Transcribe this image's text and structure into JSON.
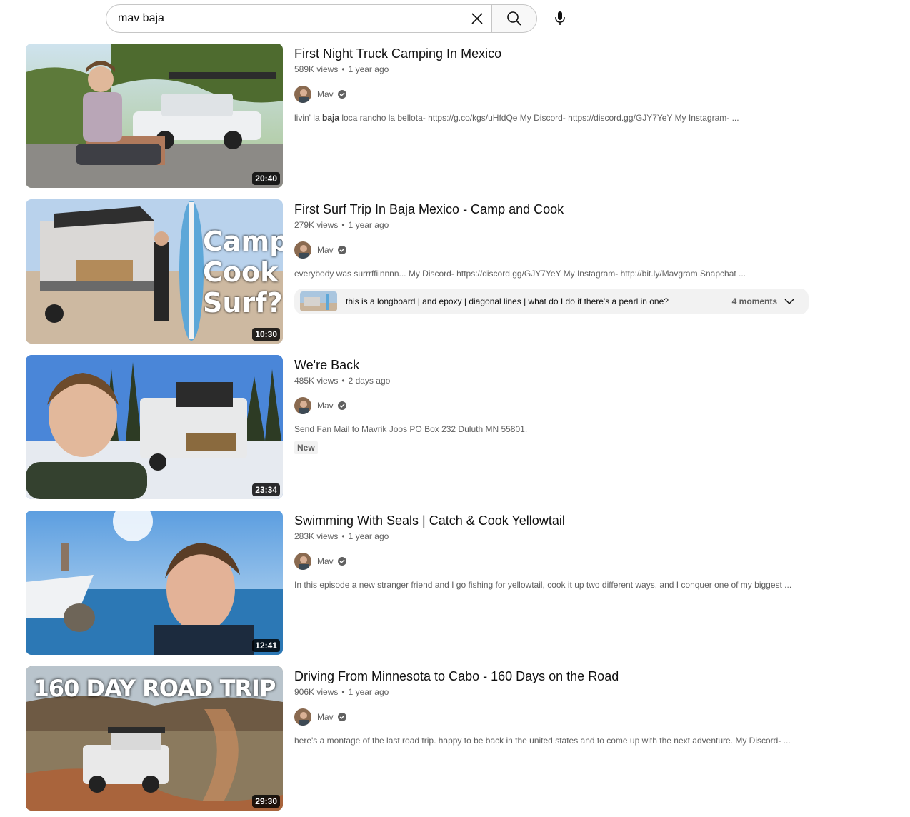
{
  "search": {
    "query": "mav baja",
    "clear_icon": "close-icon",
    "search_icon": "search-icon",
    "mic_icon": "microphone-icon"
  },
  "results": [
    {
      "title": "First Night Truck Camping In Mexico",
      "views": "589K views",
      "age": "1 year ago",
      "channel": "Mav",
      "description_pre": "livin' la ",
      "description_bold": "baja",
      "description_post": " loca rancho la bellota- https://g.co/kgs/uHfdQe My Discord- https://discord.gg/GJY7YeY My Instagram- ...",
      "duration": "20:40"
    },
    {
      "title": "First Surf Trip In Baja Mexico - Camp and Cook",
      "views": "279K views",
      "age": "1 year ago",
      "channel": "Mav",
      "description": "everybody was surrrffiinnnn... My Discord- https://discord.gg/GJY7YeY My Instagram- http://bit.ly/Mavgram Snapchat ...",
      "duration": "10:30",
      "thumb_text": [
        "Camp",
        "Cook",
        "Surf?"
      ],
      "moments": {
        "text": "this is a longboard | and epoxy | diagonal lines | what do I do if there's a pearl in one?",
        "count": "4 moments"
      }
    },
    {
      "title": "We're Back",
      "views": "485K views",
      "age": "2 days ago",
      "channel": "Mav",
      "description": "Send Fan Mail to Mavrik Joos PO Box 232 Duluth MN 55801.",
      "badge": "New",
      "duration": "23:34"
    },
    {
      "title": "Swimming With Seals | Catch & Cook Yellowtail",
      "views": "283K views",
      "age": "1 year ago",
      "channel": "Mav",
      "description": "In this episode a new stranger friend and I go fishing for yellowtail, cook it up two different ways, and I conquer one of my biggest ...",
      "duration": "12:41"
    },
    {
      "title": "Driving From Minnesota to Cabo - 160 Days on the Road",
      "views": "906K views",
      "age": "1 year ago",
      "channel": "Mav",
      "description": "here's a montage of the last road trip. happy to be back in the united states and to come up with the next adventure. My Discord- ...",
      "duration": "29:30",
      "thumb_text": "160 DAY ROAD TRIP"
    }
  ]
}
